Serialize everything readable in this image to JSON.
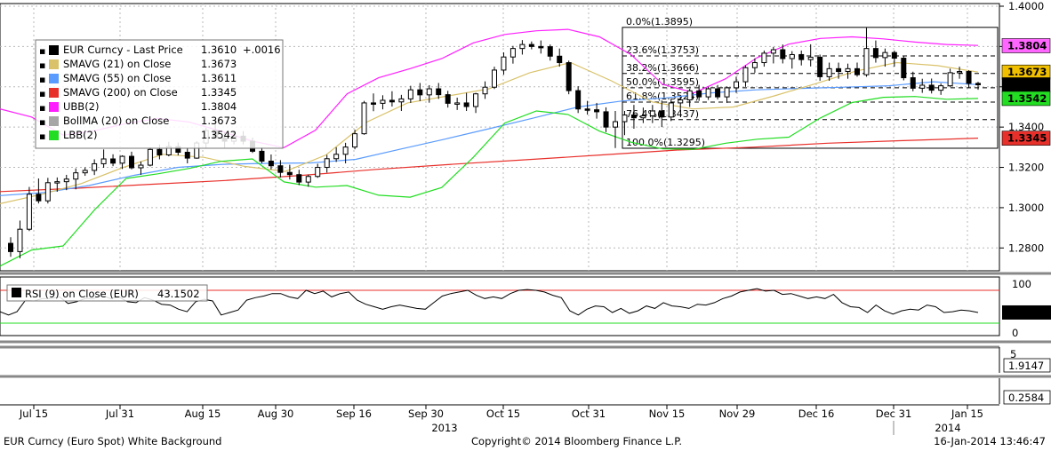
{
  "footer": {
    "left": "EUR Curncy (Euro Spot) White Background",
    "center": "Copyright© 2014 Bloomberg Finance L.P.",
    "right": "16-Jan-2014 13:46:47"
  },
  "chart_data": [
    {
      "type": "candlestick",
      "panel": "price",
      "x_ticks": [
        "Jul 15",
        "Jul 31",
        "Aug 15",
        "Aug 30",
        "Sep 16",
        "Sep 30",
        "Oct 15",
        "Oct 31",
        "Nov 15",
        "Nov 29",
        "Dec 16",
        "Dec 31",
        "Jan 15"
      ],
      "x_year_labels": [
        "2013",
        "2014"
      ],
      "y_ticks": [
        1.28,
        1.3,
        1.32,
        1.34,
        1.36,
        1.38,
        1.4
      ],
      "y_tick_labels": [
        "1.2800",
        "1.3000",
        "1.3200",
        "1.3400",
        "",
        "",
        "1.4000"
      ],
      "ylim": [
        1.27,
        1.4
      ],
      "grid": true,
      "legend": {
        "placement": "top-left",
        "header": {
          "name": "EUR Curncy - Last Price",
          "value": "1.3610",
          "change": "+.0016",
          "color": "#000000"
        },
        "entries": [
          {
            "name": "SMAVG (21) on Close",
            "value": "1.3673",
            "color": "#d9c26a"
          },
          {
            "name": "SMAVG (55) on Close",
            "value": "1.3611",
            "color": "#5a9bff"
          },
          {
            "name": "SMAVG (200) on Close",
            "value": "1.3345",
            "color": "#e8302b"
          },
          {
            "name": "UBB(2)",
            "value": "1.3804",
            "color": "#ff1eff"
          },
          {
            "name": "BollMA (20) on Close",
            "value": "1.3673",
            "color": "#a6a6a6"
          },
          {
            "name": "LBB(2)",
            "value": "1.3542",
            "color": "#22dd22"
          }
        ]
      },
      "right_badges": [
        {
          "value": 1.3804,
          "label": "1.3804",
          "bg": "#ff66ff",
          "fg": "#000000"
        },
        {
          "value": 1.3673,
          "label": "1.3673",
          "bg": "#f0c000",
          "fg": "#000000"
        },
        {
          "value": 1.361,
          "label": "1.3610",
          "bg": "#000000",
          "fg": "#ffffff"
        },
        {
          "value": 1.3542,
          "label": "1.3542",
          "bg": "#22dd22",
          "fg": "#000000"
        },
        {
          "value": 1.3345,
          "label": "1.3345",
          "bg": "#e8302b",
          "fg": "#ffffff"
        }
      ],
      "fibonacci": {
        "high": 1.3895,
        "low": 1.3295,
        "levels": [
          {
            "label": "0.0%(1.3895)",
            "value": 1.3895
          },
          {
            "label": "23.6%(1.3753)",
            "value": 1.3753
          },
          {
            "label": "38.2%(1.3666)",
            "value": 1.3666
          },
          {
            "label": "50.0%(1.3595)",
            "value": 1.3595
          },
          {
            "label": "61.8%(1.3524)",
            "value": 1.3524
          },
          {
            "label": "76.4%(1.3437)",
            "value": 1.3437
          },
          {
            "label": "100.0%(1.3295)",
            "value": 1.3295
          }
        ]
      },
      "candles": [
        [
          1.2823,
          1.2853,
          1.2756,
          1.2782
        ],
        [
          1.2782,
          1.2936,
          1.2749,
          1.2893
        ],
        [
          1.2893,
          1.3103,
          1.2884,
          1.3067
        ],
        [
          1.3067,
          1.3145,
          1.3021,
          1.3034
        ],
        [
          1.3034,
          1.3148,
          1.3021,
          1.3124
        ],
        [
          1.3124,
          1.315,
          1.3079,
          1.3129
        ],
        [
          1.3129,
          1.3163,
          1.3087,
          1.3142
        ],
        [
          1.3142,
          1.3195,
          1.3091,
          1.3173
        ],
        [
          1.3173,
          1.32,
          1.3158,
          1.3185
        ],
        [
          1.3185,
          1.324,
          1.3162,
          1.3218
        ],
        [
          1.3218,
          1.3289,
          1.3198,
          1.3242
        ],
        [
          1.3242,
          1.3265,
          1.3206,
          1.3221
        ],
        [
          1.3221,
          1.326,
          1.3192,
          1.3255
        ],
        [
          1.3255,
          1.3278,
          1.319,
          1.3198
        ],
        [
          1.3198,
          1.3229,
          1.3163,
          1.3211
        ],
        [
          1.3211,
          1.33,
          1.3205,
          1.3289
        ],
        [
          1.3289,
          1.3314,
          1.324,
          1.3262
        ],
        [
          1.3262,
          1.3327,
          1.3255,
          1.3303
        ],
        [
          1.3303,
          1.3323,
          1.326,
          1.3275
        ],
        [
          1.3275,
          1.3296,
          1.322,
          1.3246
        ],
        [
          1.3246,
          1.333,
          1.3243,
          1.3321
        ],
        [
          1.3321,
          1.3396,
          1.3293,
          1.3383
        ],
        [
          1.3383,
          1.3452,
          1.334,
          1.3345
        ],
        [
          1.3345,
          1.3372,
          1.3298,
          1.333
        ],
        [
          1.333,
          1.3382,
          1.3314,
          1.3355
        ],
        [
          1.3355,
          1.338,
          1.3314,
          1.333
        ],
        [
          1.333,
          1.3348,
          1.3272,
          1.328
        ],
        [
          1.328,
          1.3299,
          1.322,
          1.3231
        ],
        [
          1.3231,
          1.3264,
          1.319,
          1.3208
        ],
        [
          1.3208,
          1.3236,
          1.315,
          1.3175
        ],
        [
          1.3175,
          1.3213,
          1.314,
          1.3164
        ],
        [
          1.3164,
          1.3188,
          1.3112,
          1.3127
        ],
        [
          1.3127,
          1.3164,
          1.3104,
          1.3155
        ],
        [
          1.3155,
          1.3218,
          1.3148,
          1.32
        ],
        [
          1.32,
          1.3262,
          1.3174,
          1.3243
        ],
        [
          1.3243,
          1.33,
          1.3227,
          1.3265
        ],
        [
          1.3265,
          1.3322,
          1.322,
          1.3301
        ],
        [
          1.3301,
          1.3387,
          1.329,
          1.3367
        ],
        [
          1.3367,
          1.353,
          1.3362,
          1.352
        ],
        [
          1.352,
          1.3567,
          1.3479,
          1.3518
        ],
        [
          1.3518,
          1.3558,
          1.3488,
          1.3533
        ],
        [
          1.3533,
          1.3578,
          1.3502,
          1.3525
        ],
        [
          1.3525,
          1.356,
          1.348,
          1.354
        ],
        [
          1.354,
          1.3605,
          1.352,
          1.3585
        ],
        [
          1.3585,
          1.3619,
          1.3529,
          1.356
        ],
        [
          1.356,
          1.3608,
          1.3521,
          1.359
        ],
        [
          1.359,
          1.3619,
          1.354,
          1.3561
        ],
        [
          1.3561,
          1.358,
          1.3497,
          1.3518
        ],
        [
          1.3518,
          1.3546,
          1.3485,
          1.352
        ],
        [
          1.352,
          1.357,
          1.348,
          1.3502
        ],
        [
          1.3502,
          1.357,
          1.347,
          1.3565
        ],
        [
          1.3565,
          1.3627,
          1.354,
          1.3598
        ],
        [
          1.3598,
          1.37,
          1.3589,
          1.3683
        ],
        [
          1.3683,
          1.3771,
          1.366,
          1.3748
        ],
        [
          1.3748,
          1.3803,
          1.3715,
          1.379
        ],
        [
          1.379,
          1.3832,
          1.376,
          1.381
        ],
        [
          1.381,
          1.3825,
          1.3786,
          1.38
        ],
        [
          1.38,
          1.383,
          1.3765,
          1.3799
        ],
        [
          1.3799,
          1.381,
          1.373,
          1.3752
        ],
        [
          1.3752,
          1.379,
          1.37,
          1.372
        ],
        [
          1.372,
          1.373,
          1.3563,
          1.3581
        ],
        [
          1.3581,
          1.3603,
          1.347,
          1.349
        ],
        [
          1.349,
          1.353,
          1.3462,
          1.3486
        ],
        [
          1.3486,
          1.352,
          1.3442,
          1.3476
        ],
        [
          1.3476,
          1.3498,
          1.3375,
          1.34
        ],
        [
          1.34,
          1.348,
          1.3296,
          1.3427
        ],
        [
          1.3427,
          1.348,
          1.336,
          1.346
        ],
        [
          1.346,
          1.351,
          1.3392,
          1.3446
        ],
        [
          1.3446,
          1.3497,
          1.342,
          1.3456
        ],
        [
          1.3456,
          1.351,
          1.342,
          1.348
        ],
        [
          1.348,
          1.3532,
          1.34,
          1.345
        ],
        [
          1.345,
          1.354,
          1.343,
          1.352
        ],
        [
          1.352,
          1.355,
          1.348,
          1.3535
        ],
        [
          1.3535,
          1.359,
          1.35,
          1.358
        ],
        [
          1.358,
          1.361,
          1.353,
          1.355
        ],
        [
          1.355,
          1.36,
          1.3535,
          1.359
        ],
        [
          1.359,
          1.3609,
          1.3537,
          1.355
        ],
        [
          1.355,
          1.3602,
          1.352,
          1.3595
        ],
        [
          1.3595,
          1.365,
          1.357,
          1.3625
        ],
        [
          1.3625,
          1.3706,
          1.36,
          1.3695
        ],
        [
          1.3695,
          1.3741,
          1.367,
          1.372
        ],
        [
          1.372,
          1.378,
          1.37,
          1.3767
        ],
        [
          1.3767,
          1.3798,
          1.3716,
          1.3784
        ],
        [
          1.3784,
          1.381,
          1.3716,
          1.374
        ],
        [
          1.374,
          1.3777,
          1.369,
          1.376
        ],
        [
          1.376,
          1.378,
          1.3706,
          1.3735
        ],
        [
          1.3735,
          1.3811,
          1.3701,
          1.3747
        ],
        [
          1.3747,
          1.376,
          1.363,
          1.365
        ],
        [
          1.365,
          1.372,
          1.363,
          1.369
        ],
        [
          1.369,
          1.372,
          1.364,
          1.3676
        ],
        [
          1.3676,
          1.3715,
          1.364,
          1.369
        ],
        [
          1.369,
          1.372,
          1.365,
          1.366
        ],
        [
          1.366,
          1.3893,
          1.365,
          1.379
        ],
        [
          1.379,
          1.383,
          1.372,
          1.3745
        ],
        [
          1.3745,
          1.379,
          1.37,
          1.377
        ],
        [
          1.377,
          1.378,
          1.37,
          1.3742
        ],
        [
          1.3742,
          1.3755,
          1.3632,
          1.3645
        ],
        [
          1.3645,
          1.3675,
          1.3578,
          1.3593
        ],
        [
          1.3593,
          1.364,
          1.357,
          1.3608
        ],
        [
          1.3608,
          1.3641,
          1.3567,
          1.3583
        ],
        [
          1.3583,
          1.3617,
          1.356,
          1.3605
        ],
        [
          1.3605,
          1.369,
          1.3598,
          1.367
        ],
        [
          1.367,
          1.37,
          1.364,
          1.3676
        ],
        [
          1.3676,
          1.3682,
          1.3595,
          1.3617
        ],
        [
          1.3617,
          1.3625,
          1.3585,
          1.361
        ]
      ],
      "series": [
        {
          "name": "SMAVG (200) on Close",
          "color": "#e8302b",
          "values": [
            1.308,
            1.3096,
            1.3116,
            1.3135,
            1.316,
            1.319,
            1.3215,
            1.3238,
            1.3262,
            1.3286,
            1.33,
            1.332,
            1.3333,
            1.3345
          ]
        },
        {
          "name": "SMAVG (55) on Close",
          "color": "#5a9bff",
          "values": [
            1.306,
            1.3075,
            1.311,
            1.316,
            1.32,
            1.3215,
            1.322,
            1.3222,
            1.324,
            1.329,
            1.334,
            1.3392,
            1.3445,
            1.35,
            1.353,
            1.3545,
            1.357,
            1.3585,
            1.3592,
            1.3598,
            1.3605,
            1.3625,
            1.3611
          ]
        },
        {
          "name": "SMAVG (21) on Close",
          "color": "#d9c26a",
          "values": [
            1.302,
            1.3065,
            1.312,
            1.3198,
            1.3265,
            1.325,
            1.3205,
            1.318,
            1.3262,
            1.3425,
            1.352,
            1.3555,
            1.359,
            1.367,
            1.372,
            1.363,
            1.3525,
            1.349,
            1.35,
            1.3555,
            1.3615,
            1.3678,
            1.372,
            1.3705,
            1.3673
          ]
        },
        {
          "name": "UBB(2)",
          "color": "#ff1eff",
          "values": [
            1.349,
            1.345,
            1.336,
            1.3382,
            1.3418,
            1.3443,
            1.3425,
            1.338,
            1.333,
            1.3298,
            1.3385,
            1.3565,
            1.3645,
            1.369,
            1.374,
            1.3818,
            1.386,
            1.3878,
            1.3885,
            1.3848,
            1.376,
            1.3612,
            1.357,
            1.364,
            1.3745,
            1.3812,
            1.384,
            1.3848,
            1.3838,
            1.3822,
            1.381,
            1.3805
          ]
        },
        {
          "name": "LBB(2)",
          "color": "#22dd22",
          "values": [
            1.271,
            1.279,
            1.281,
            1.299,
            1.3145,
            1.3168,
            1.3195,
            1.323,
            1.3242,
            1.3128,
            1.3102,
            1.311,
            1.3062,
            1.3052,
            1.31,
            1.325,
            1.342,
            1.348,
            1.3463,
            1.338,
            1.3325,
            1.3292,
            1.329,
            1.332,
            1.334,
            1.335,
            1.3445,
            1.3522,
            1.3548,
            1.3552,
            1.3538,
            1.3542
          ]
        }
      ]
    },
    {
      "type": "line",
      "panel": "rsi",
      "legend_name": "RSI (9) on Close (EUR)",
      "legend_value": "43.1502",
      "y_ticks": [
        0,
        100
      ],
      "ylim": [
        0,
        100
      ],
      "levels": [
        70,
        30
      ],
      "badge": {
        "label": "43.1502",
        "bg": "#000000",
        "fg": "#ffffff"
      },
      "values": [
        44,
        40,
        44,
        58,
        57,
        60,
        60,
        62,
        54,
        56,
        60,
        60,
        64,
        60,
        62,
        56,
        55,
        61,
        58,
        53,
        52,
        47,
        44,
        56,
        59,
        57,
        40,
        43,
        46,
        58,
        61,
        63,
        66,
        66,
        62,
        60,
        70,
        66,
        69,
        62,
        66,
        68,
        58,
        53,
        50,
        47,
        50,
        52,
        50,
        48,
        47,
        55,
        63,
        66,
        68,
        70,
        64,
        60,
        62,
        60,
        66,
        70,
        71,
        70,
        68,
        64,
        61,
        45,
        40,
        47,
        51,
        50,
        43,
        48,
        42,
        45,
        51,
        48,
        55,
        51,
        50,
        48,
        53,
        52,
        55,
        60,
        63,
        68,
        70,
        72,
        69,
        70,
        65,
        66,
        63,
        60,
        62,
        60,
        65,
        55,
        50,
        49,
        43,
        52,
        45,
        41,
        45,
        47,
        46,
        52,
        50,
        43,
        44,
        46,
        45,
        43
      ]
    },
    {
      "type": "indicator",
      "panel": "lower-1",
      "y_ticks": [
        5
      ],
      "badge": {
        "label": "1.9147"
      }
    },
    {
      "type": "indicator",
      "panel": "lower-2",
      "badge": {
        "label": "0.2584"
      }
    }
  ]
}
